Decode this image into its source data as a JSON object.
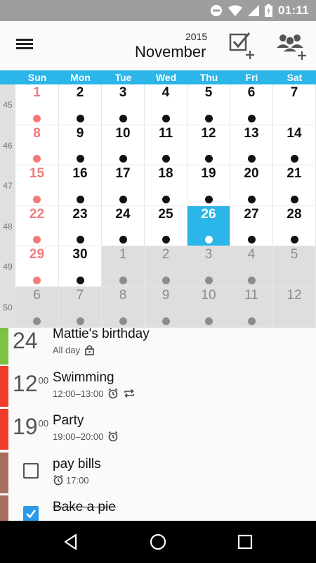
{
  "status_bar": {
    "time": "01:11"
  },
  "app_bar": {
    "year": "2015",
    "month": "November",
    "menu_icon": "menu-icon",
    "add_task_icon": "add-task-icon",
    "add_contact_icon": "add-contact-icon"
  },
  "weekdays": [
    "Sun",
    "Mon",
    "Tue",
    "Wed",
    "Thu",
    "Fri",
    "Sat"
  ],
  "week_numbers": [
    "45",
    "46",
    "47",
    "48",
    "49",
    "50"
  ],
  "calendar": {
    "selected_day": "26",
    "weeks": [
      [
        {
          "day": "1",
          "month": "current",
          "event": true
        },
        {
          "day": "2",
          "month": "current",
          "event": true
        },
        {
          "day": "3",
          "month": "current",
          "event": true
        },
        {
          "day": "4",
          "month": "current",
          "event": true
        },
        {
          "day": "5",
          "month": "current",
          "event": true
        },
        {
          "day": "6",
          "month": "current",
          "event": true
        },
        {
          "day": "7",
          "month": "current",
          "event": false
        }
      ],
      [
        {
          "day": "8",
          "month": "current",
          "event": true
        },
        {
          "day": "9",
          "month": "current",
          "event": true
        },
        {
          "day": "10",
          "month": "current",
          "event": true
        },
        {
          "day": "11",
          "month": "current",
          "event": true
        },
        {
          "day": "12",
          "month": "current",
          "event": true
        },
        {
          "day": "13",
          "month": "current",
          "event": true
        },
        {
          "day": "14",
          "month": "current",
          "event": true
        }
      ],
      [
        {
          "day": "15",
          "month": "current",
          "event": true
        },
        {
          "day": "16",
          "month": "current",
          "event": true
        },
        {
          "day": "17",
          "month": "current",
          "event": true
        },
        {
          "day": "18",
          "month": "current",
          "event": true
        },
        {
          "day": "19",
          "month": "current",
          "event": true
        },
        {
          "day": "20",
          "month": "current",
          "event": true
        },
        {
          "day": "21",
          "month": "current",
          "event": true
        }
      ],
      [
        {
          "day": "22",
          "month": "current",
          "event": true
        },
        {
          "day": "23",
          "month": "current",
          "event": true
        },
        {
          "day": "24",
          "month": "current",
          "event": true
        },
        {
          "day": "25",
          "month": "current",
          "event": true
        },
        {
          "day": "26",
          "month": "current",
          "event": true
        },
        {
          "day": "27",
          "month": "current",
          "event": true
        },
        {
          "day": "28",
          "month": "current",
          "event": true
        }
      ],
      [
        {
          "day": "29",
          "month": "current",
          "event": true
        },
        {
          "day": "30",
          "month": "current",
          "event": true
        },
        {
          "day": "1",
          "month": "other",
          "event": true
        },
        {
          "day": "2",
          "month": "other",
          "event": true
        },
        {
          "day": "3",
          "month": "other",
          "event": true
        },
        {
          "day": "4",
          "month": "other",
          "event": true
        },
        {
          "day": "5",
          "month": "other",
          "event": false
        }
      ],
      [
        {
          "day": "6",
          "month": "other",
          "event": true
        },
        {
          "day": "7",
          "month": "other",
          "event": true
        },
        {
          "day": "8",
          "month": "other",
          "event": true
        },
        {
          "day": "9",
          "month": "other",
          "event": true
        },
        {
          "day": "10",
          "month": "other",
          "event": true
        },
        {
          "day": "11",
          "month": "other",
          "event": true
        },
        {
          "day": "12",
          "month": "other",
          "event": false
        }
      ]
    ]
  },
  "agenda": [
    {
      "kind": "event",
      "big": "24",
      "sup": "",
      "title": "Mattie's birthday",
      "sub": "All day",
      "icons": [
        "lock-icon"
      ],
      "color": "#7dc242"
    },
    {
      "kind": "event",
      "big": "12",
      "sup": "00",
      "title": "Swimming",
      "sub": "12:00–13:00",
      "icons": [
        "alarm-icon",
        "repeat-icon"
      ],
      "color": "#f23c2c"
    },
    {
      "kind": "event",
      "big": "19",
      "sup": "00",
      "title": "Party",
      "sub": "19:00–20:00",
      "icons": [
        "alarm-icon"
      ],
      "color": "#f23c2c"
    },
    {
      "kind": "task",
      "checked": false,
      "title": "pay bills",
      "sub": "17:00",
      "icons": [
        "alarm-icon"
      ],
      "color": "#a6705c"
    },
    {
      "kind": "task",
      "checked": true,
      "title": "Bake a pie",
      "sub": "",
      "icons": [],
      "color": "#a6705c"
    }
  ],
  "colors": {
    "accent": "#2bb5e8",
    "sunday": "#f27a7a"
  },
  "nav": {
    "back_icon": "back-icon",
    "home_icon": "home-icon",
    "recents_icon": "recents-icon"
  }
}
